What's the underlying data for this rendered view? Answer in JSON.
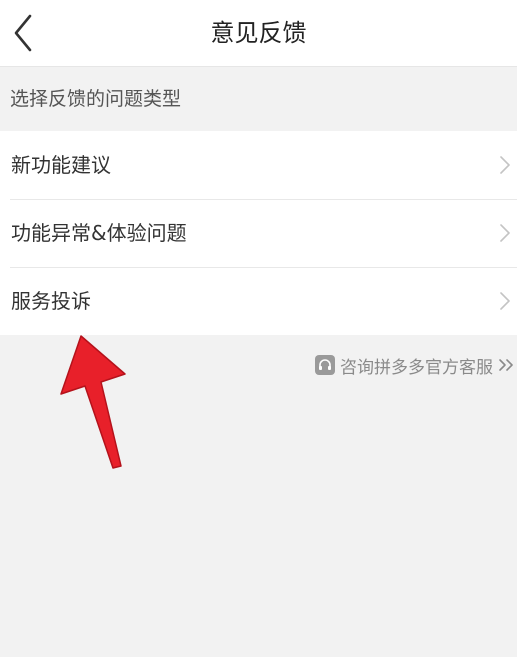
{
  "header": {
    "title": "意见反馈",
    "back_icon": "chevron-left-icon"
  },
  "section": {
    "title": "选择反馈的问题类型"
  },
  "feedback_types": [
    {
      "label": "新功能建议"
    },
    {
      "label": "功能异常&体验问题"
    },
    {
      "label": "服务投诉"
    }
  ],
  "support": {
    "label": "咨询拼多多官方客服",
    "icon": "headset-icon",
    "trailing_icon": "double-chevron-right-icon"
  },
  "colors": {
    "background": "#f2f2f2",
    "surface": "#ffffff",
    "annotation_arrow": "#e8202a"
  }
}
